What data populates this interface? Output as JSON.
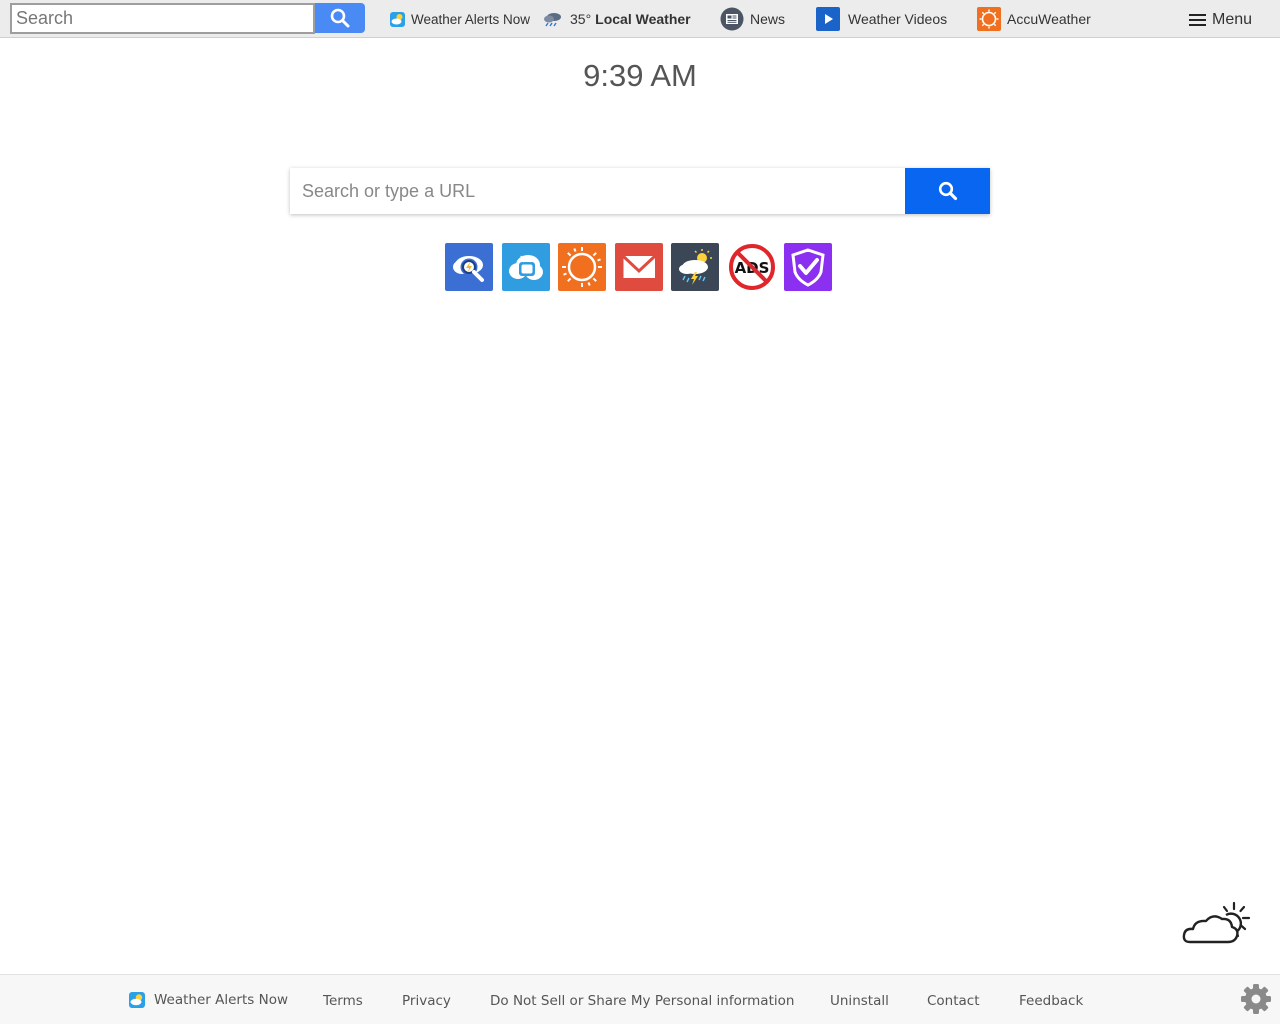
{
  "toolbar": {
    "search_placeholder": "Search",
    "links": [
      {
        "label": "Weather Alerts Now",
        "icon": "weather-alerts-app-icon"
      },
      {
        "temp": "35°",
        "label": "Local Weather",
        "icon": "rain-cloud-icon"
      },
      {
        "label": "News",
        "icon": "newspaper-icon"
      },
      {
        "label": "Weather Videos",
        "icon": "play-video-icon"
      },
      {
        "label": "AccuWeather",
        "icon": "sun-icon"
      }
    ],
    "menu_label": "Menu"
  },
  "clock": {
    "time": "9:39 AM"
  },
  "main_search": {
    "placeholder": "Search or type a URL"
  },
  "shortcuts": [
    {
      "icon": "cloud-search-icon",
      "color": "#3b6fd4"
    },
    {
      "icon": "cloud-tv-icon",
      "color": "#2f9ddf"
    },
    {
      "icon": "sun-icon",
      "color": "#f0701f"
    },
    {
      "icon": "mail-icon",
      "color": "#e04b3f"
    },
    {
      "icon": "storm-cloud-icon",
      "color": "#3b4656"
    },
    {
      "icon": "no-ads-icon",
      "color": "#ffffff"
    },
    {
      "icon": "shield-check-icon",
      "color": "#8b2ff0"
    }
  ],
  "footer": {
    "brand": "Weather Alerts Now",
    "links": [
      "Terms",
      "Privacy",
      "Do Not Sell or Share My Personal information",
      "Uninstall",
      "Contact",
      "Feedback"
    ]
  },
  "colors": {
    "toolbar_bg": "#ececec",
    "toolbar_search_button": "#4a8af4",
    "main_search_button": "#0866f0",
    "footer_bg": "#f7f7f7"
  }
}
